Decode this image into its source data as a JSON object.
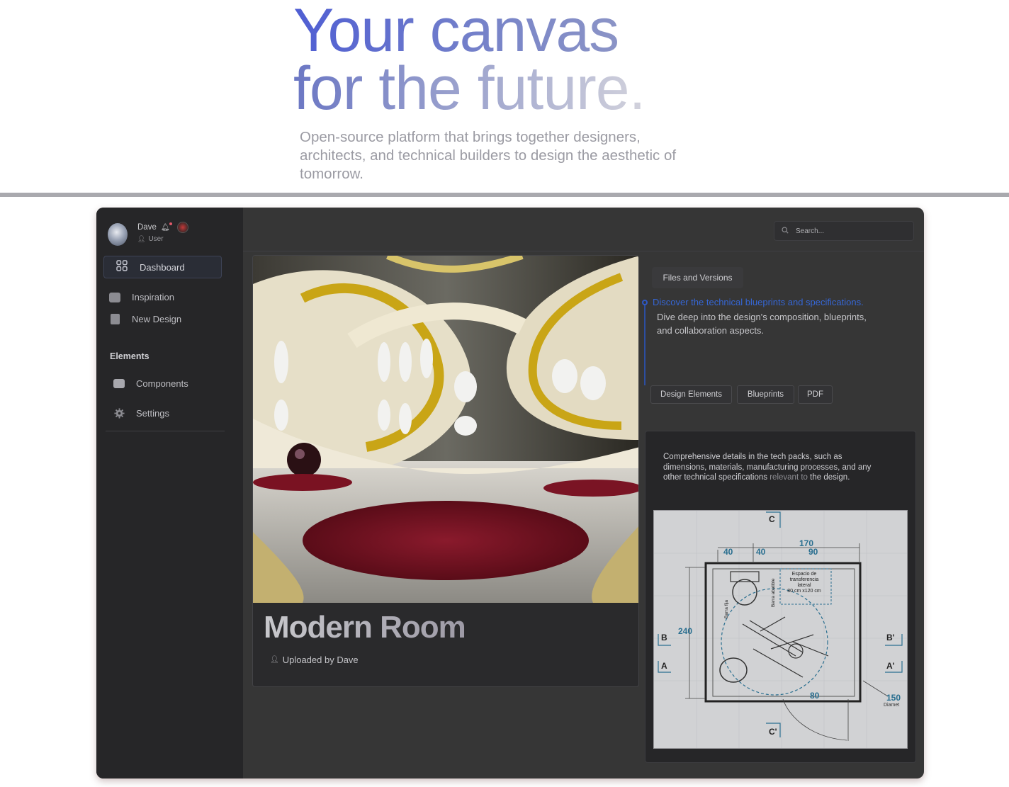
{
  "hero": {
    "title_line1": "Your canvas",
    "title_line2": "for the future.",
    "subtitle": "Open-source platform that brings together designers, architects, and technical builders to design the aesthetic of tomorrow."
  },
  "sidebar": {
    "user_name": "Dave",
    "user_role": "User",
    "items": [
      {
        "label": "Dashboard",
        "icon": "grid-icon"
      },
      {
        "label": "Inspiration",
        "icon": "gamepad-icon"
      },
      {
        "label": "New Design",
        "icon": "document-icon"
      }
    ],
    "section_title": "Elements",
    "section_items": [
      {
        "label": "Components",
        "icon": "wallet-icon"
      },
      {
        "label": "Settings",
        "icon": "gear-icon"
      }
    ]
  },
  "topbar": {
    "search_placeholder": "Search..."
  },
  "card": {
    "title": "Modern Room",
    "uploaded_by": "Uploaded by Dave"
  },
  "details": {
    "tab_label": "Files and Versions",
    "timeline_heading": "Discover the technical blueprints and specifications.",
    "timeline_body": "Dive deep into the design's composition, blueprints, and collaboration aspects.",
    "chips": [
      "Design Elements",
      "Blueprints",
      "PDF"
    ],
    "tech_text_a": "Comprehensive details in the tech packs, such as dimensions, materials, manufacturing processes, and any other technical specifications",
    "tech_text_b": " relevant to",
    "tech_text_c": " the design."
  },
  "blueprint": {
    "labels": {
      "c_top": "C",
      "c_bottom": "C'",
      "b_left": "B",
      "b_right": "B'",
      "a_left": "A",
      "a_right": "A'",
      "dim_total": "170",
      "dim_a": "40",
      "dim_b": "40",
      "dim_c": "90",
      "dim_height": "240",
      "dim_80": "80",
      "dim_150": "150",
      "diameter": "Diamet",
      "transfer_1": "Espacio de",
      "transfer_2": "transferencia",
      "transfer_3": "lateral",
      "transfer_4": "80 cm x120 cm",
      "bar_fixed": "Barra fija",
      "bar_fold": "Barra abatible"
    }
  }
}
